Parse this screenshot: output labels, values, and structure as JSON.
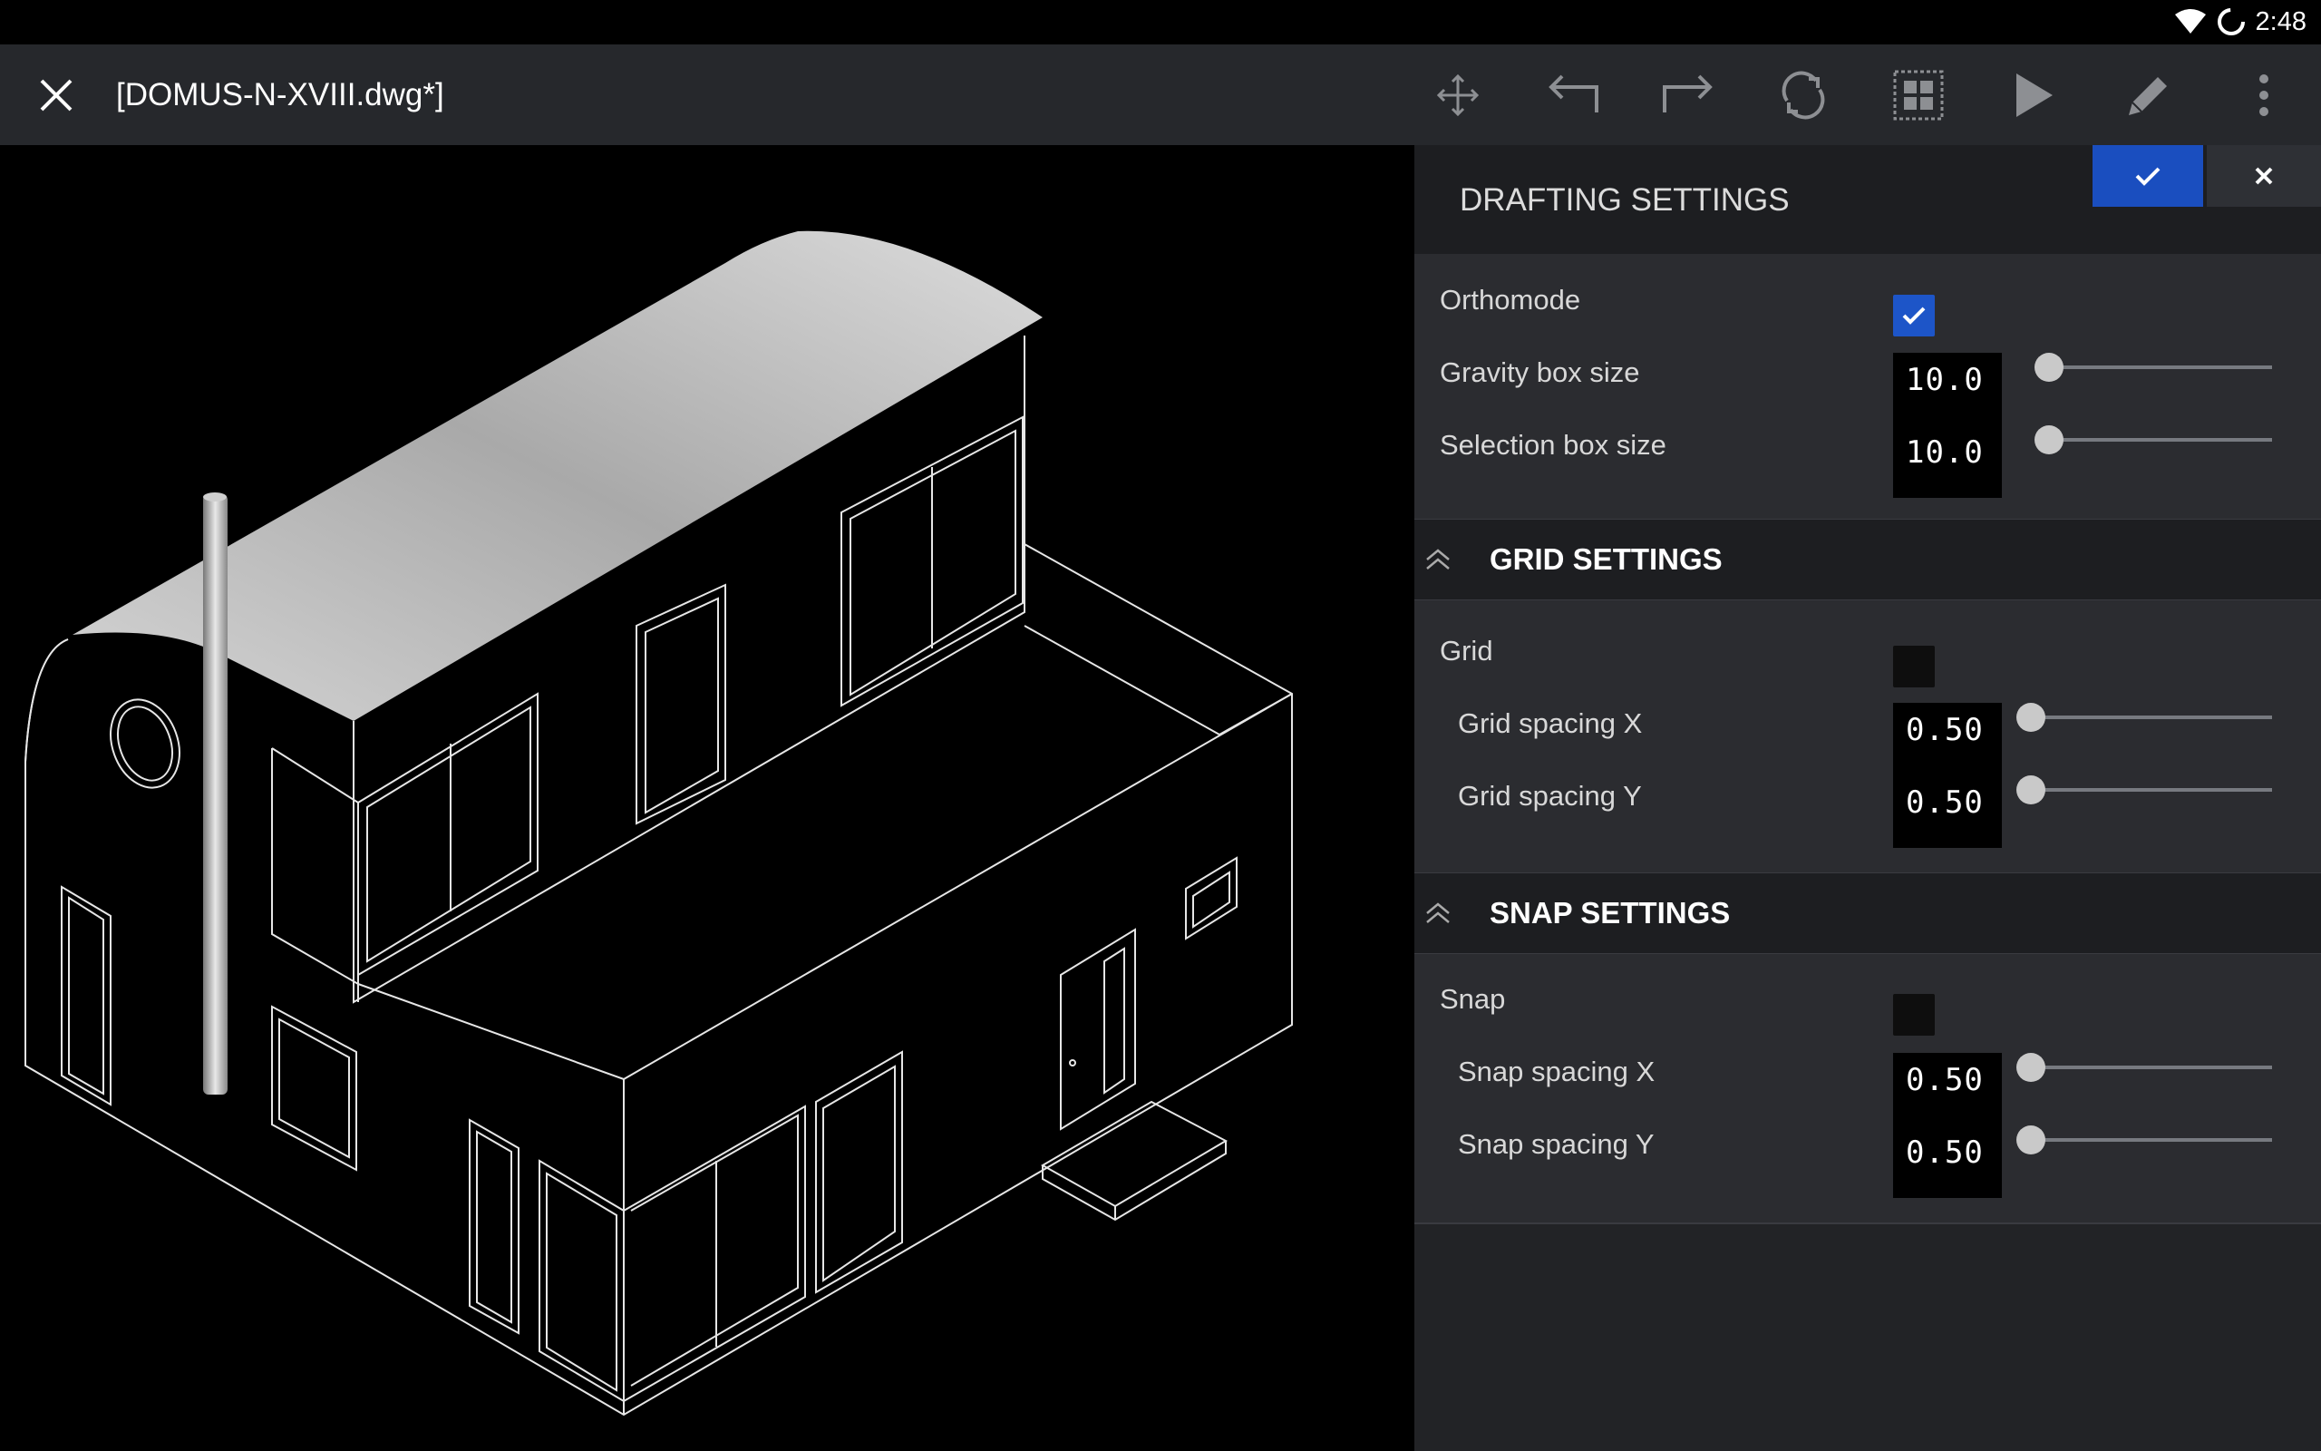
{
  "status_bar": {
    "time": "2:48"
  },
  "toolbar": {
    "title": "[DOMUS-N-XVIII.dwg*]",
    "icons": [
      "move-icon",
      "undo-icon",
      "redo-icon",
      "orbit-icon",
      "select-window-icon",
      "play-icon",
      "edit-icon",
      "more-vert-icon"
    ]
  },
  "drafting": {
    "title": "DRAFTING SETTINGS",
    "orthomode_label": "Orthomode",
    "orthomode_checked": true,
    "gravity_label": "Gravity box size",
    "gravity_value": "10.0",
    "selection_label": "Selection box size",
    "selection_value": "10.0"
  },
  "grid": {
    "title": "GRID SETTINGS",
    "grid_label": "Grid",
    "grid_checked": false,
    "spacing_x_label": "Grid spacing X",
    "spacing_x_value": "0.50",
    "spacing_y_label": "Grid spacing Y",
    "spacing_y_value": "0.50"
  },
  "snap": {
    "title": "SNAP SETTINGS",
    "snap_label": "Snap",
    "snap_checked": false,
    "spacing_x_label": "Snap spacing X",
    "spacing_x_value": "0.50",
    "spacing_y_label": "Snap spacing Y",
    "spacing_y_value": "0.50"
  },
  "colors": {
    "accent": "#1a4ebf",
    "panel": "#2b2c30",
    "toolbar": "#26282c"
  }
}
